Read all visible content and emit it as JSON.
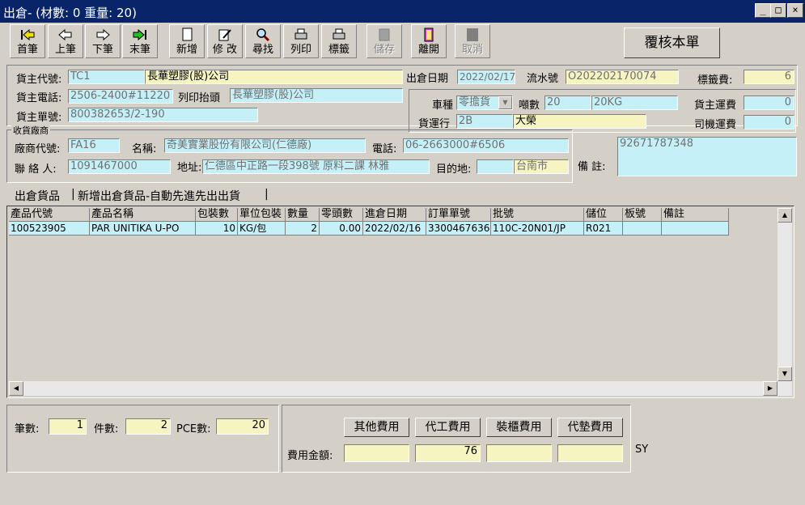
{
  "title": "出倉- (材數: 0   重量: 20)",
  "toolbar": {
    "first": "首筆",
    "prev": "上筆",
    "next": "下筆",
    "last": "末筆",
    "add": "新增",
    "edit": "修 改",
    "find": "尋找",
    "print": "列印",
    "label": "標籤",
    "save": "儲存",
    "exit": "離開",
    "cancel": "取消",
    "review": "覆核本單"
  },
  "header": {
    "owner_code_label": "貨主代號:",
    "owner_code": "TC1",
    "owner_name": "長華塑膠(股)公司",
    "out_date_label": "出倉日期",
    "out_date": "2022/02/17",
    "serial_label": "流水號",
    "serial": "O202202170074",
    "label_fee_label": "標籤費:",
    "label_fee": "6",
    "owner_phone_label": "貨主電話:",
    "owner_phone": "2506-2400#11220",
    "print_title_label": "列印抬頭",
    "print_title": "長華塑膠(股)公司",
    "vehicle_label": "車種",
    "vehicle": "零擔貨",
    "tons_label": "噸數",
    "tons": "20",
    "tons_unit": "20KG",
    "owner_freight_label": "貨主運費",
    "owner_freight": "0",
    "owner_doc_label": "貨主單號:",
    "owner_doc": "800382653/2-190",
    "carrier_label": "貨運行",
    "carrier_code": "2B",
    "carrier_name": "大榮",
    "driver_freight_label": "司機運費",
    "driver_freight": "0"
  },
  "receiver": {
    "group_label": "收貨廠商",
    "vendor_code_label": "廠商代號:",
    "vendor_code": "FA16",
    "name_label": "名稱:",
    "name": "奇美實業股份有限公司(仁德廠)",
    "phone_label": "電話:",
    "phone": "06-2663000#6506",
    "contact_label": "聯 絡 人:",
    "contact": "1091467000",
    "address_label": "地址:",
    "address": "仁德區中正路一段398號 原料二課 林雅",
    "destination_label": "目的地:",
    "destination_code": "",
    "destination": "台南市",
    "remark_label": "備  註:",
    "remark": "92671787348"
  },
  "tabs": [
    "出倉貨品",
    "新增出倉貨品-自動先進先出出貨"
  ],
  "table": {
    "columns": [
      "產品代號",
      "產品名稱",
      "包裝數",
      "單位包裝",
      "數量",
      "零頭數",
      "進倉日期",
      "訂單單號",
      "批號",
      "儲位",
      "板號",
      "備註"
    ],
    "rows": [
      [
        "100523905",
        "PAR UNITIKA U-PO",
        "10",
        "KG/包",
        "2",
        "0.00",
        "2022/02/16",
        "3300467636",
        "110C-20N01/JP",
        "R021",
        "",
        ""
      ]
    ]
  },
  "footer": {
    "records_label": "筆數:",
    "records": "1",
    "pieces_label": "件數:",
    "pieces": "2",
    "pce_label": "PCE數:",
    "pce": "20",
    "other_fee": "其他費用",
    "process_fee": "代工費用",
    "container_fee": "裝櫃費用",
    "advance_fee": "代墊費用",
    "amount_label": "費用金額:",
    "amounts": [
      "",
      "76",
      "",
      ""
    ],
    "user": "SY"
  }
}
